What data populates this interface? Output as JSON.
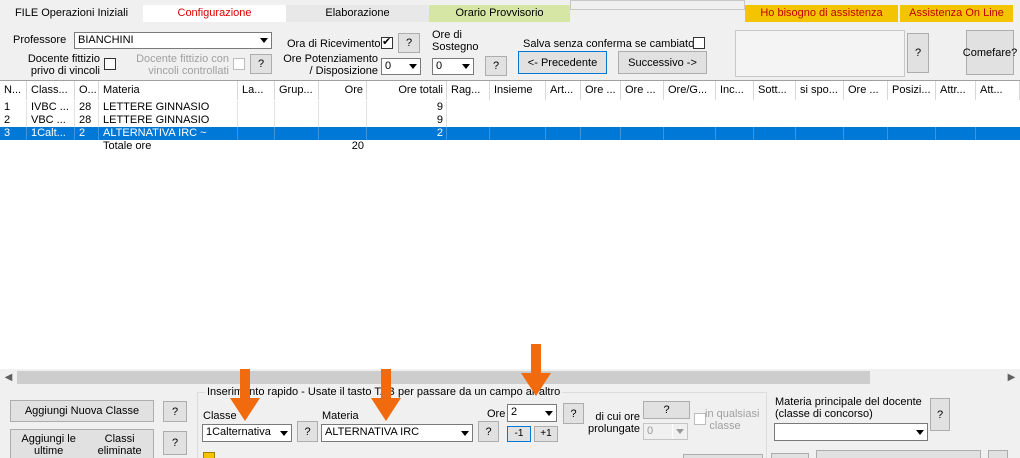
{
  "menu": {
    "file": "FILE Operazioni Iniziali",
    "configurazione": "Configurazione",
    "elaborazione": "Elaborazione",
    "orario": "Orario Provvisorio",
    "assistenza": "Ho bisogno di assistenza",
    "online": "Assistenza On Line"
  },
  "header": {
    "professore_label": "Professore",
    "professore_value": "BIANCHINI",
    "docente_fittizio_line1": "Docente fittizio",
    "docente_fittizio_line2": "privo di vincoli",
    "docente_fittizio_contr_line1": "Docente fittizio con",
    "docente_fittizio_contr_line2": "vincoli controllati",
    "help": "?",
    "ora_ricevimento_label": "Ora di Ricevimento",
    "ora_ricevimento_checked": true,
    "ore_potenziamento_line1": "Ore Potenziamento",
    "ore_potenziamento_line2": "/ Disposizione",
    "ore_potenziamento_value": "0",
    "ore_sostegno_line1": "Ore di",
    "ore_sostegno_line2": "Sostegno",
    "ore_sostegno_value": "0",
    "salva_label": "Salva senza conferma se cambiato",
    "precedente": "<- Precedente",
    "successivo": "Successivo ->",
    "come_fare_line1": "Come",
    "come_fare_line2": "fare?"
  },
  "grid": {
    "columns": [
      "N...",
      "Class...",
      "O...",
      "Materia",
      "La...",
      "Grup...",
      "Ore",
      "Ore totali",
      "Rag...",
      "Insieme",
      "Art...",
      "Ore ...",
      "Ore ...",
      "Ore/G...",
      "Inc...",
      "Sott...",
      "si spo...",
      "Ore ...",
      "Posizi...",
      "Attr...",
      "Att..."
    ],
    "rows": [
      {
        "n": "1",
        "classe": "IVBC ...",
        "o": "28",
        "materia": "LETTERE GINNASIO",
        "ore": "",
        "ore_totali": "9",
        "selected": false
      },
      {
        "n": "2",
        "classe": "VBC ...",
        "o": "28",
        "materia": "LETTERE GINNASIO",
        "ore": "",
        "ore_totali": "9",
        "selected": false
      },
      {
        "n": "3",
        "classe": "1Calt...",
        "o": "2",
        "materia": "ALTERNATIVA IRC ~",
        "ore": "",
        "ore_totali": "2",
        "selected": true
      },
      {
        "n": "",
        "classe": "",
        "o": "",
        "materia": "Totale ore",
        "ore": "20",
        "ore_totali": "",
        "selected": false
      }
    ]
  },
  "bottom": {
    "aggiungi_nuova": "Aggiungi Nuova Classe",
    "aggiungi_ultime_line1": "Aggiungi le ultime",
    "aggiungi_ultime_line2": "Classi eliminate",
    "inserimento_title": "Inserimento rapido - Usate il tasto TAB per passare da un campo all'altro",
    "classe_label": "Classe",
    "classe_value": "1Calternativa",
    "materia_label": "Materia",
    "materia_value": "ALTERNATIVA IRC",
    "ore_label": "Ore",
    "ore_value": "2",
    "minus": "-1",
    "plus": "+1",
    "di_cui_line1": "di cui ore",
    "di_cui_line2": "prolungate",
    "prolungate_value": "0",
    "qualsiasi_line1": "in qualsiasi",
    "qualsiasi_line2": "classe",
    "materia_principale_line1": "Materia principale del docente",
    "materia_principale_line2": "(classe di concorso)",
    "materia_principale_value": ""
  },
  "colors": {
    "accent_arrow": "#f26a0e",
    "selection": "#0078d7",
    "menu_orario_bg": "#d5e6a5",
    "menu_assist_bg": "#f5c400",
    "menu_config_text": "#e00000"
  }
}
